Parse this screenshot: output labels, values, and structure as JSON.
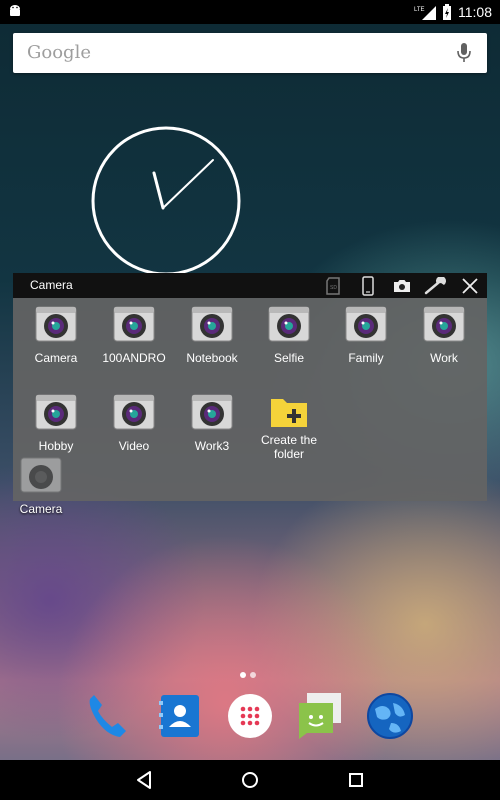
{
  "status_bar": {
    "network": "LTE",
    "time": "11:08"
  },
  "search": {
    "placeholder": "Google"
  },
  "folder": {
    "title": "Camera",
    "tools": [
      "sd-card-icon",
      "phone-icon",
      "camera-icon",
      "wrench-icon",
      "close-icon"
    ],
    "items": [
      {
        "label": "Camera",
        "icon": "camera-app-icon"
      },
      {
        "label": "100ANDRO",
        "icon": "camera-app-icon"
      },
      {
        "label": "Notebook",
        "icon": "camera-app-icon"
      },
      {
        "label": "Selfie",
        "icon": "camera-app-icon"
      },
      {
        "label": "Family",
        "icon": "camera-app-icon"
      },
      {
        "label": "Work",
        "icon": "camera-app-icon"
      },
      {
        "label": "Hobby",
        "icon": "camera-app-icon"
      },
      {
        "label": "Video",
        "icon": "camera-app-icon"
      },
      {
        "label": "Work3",
        "icon": "camera-app-icon"
      },
      {
        "label": "Create the folder",
        "icon": "add-folder-icon"
      }
    ]
  },
  "desktop": {
    "camera_label": "Camera"
  },
  "dock": [
    "phone-app-icon",
    "contacts-app-icon",
    "all-apps-icon",
    "messaging-app-icon",
    "browser-app-icon"
  ],
  "colors": {
    "folder_bg": "#646464",
    "folder_header": "#111111",
    "add_folder": "#f5d33a",
    "phone_blue": "#1e88e5",
    "messaging_green": "#8bc34a"
  }
}
